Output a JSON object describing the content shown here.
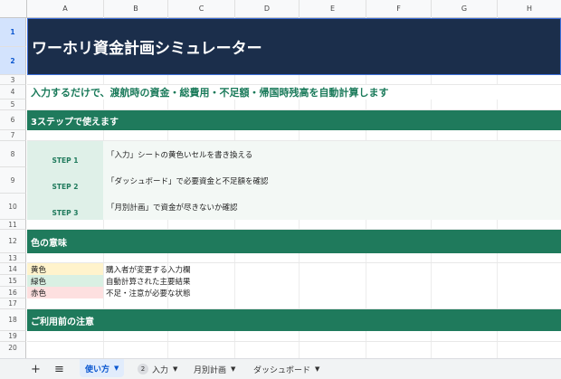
{
  "columns": [
    "A",
    "B",
    "C",
    "D",
    "E",
    "F",
    "G",
    "H"
  ],
  "rows": [
    "1",
    "2",
    "3",
    "4",
    "5",
    "6",
    "7",
    "8",
    "9",
    "10",
    "11",
    "12",
    "13",
    "14",
    "15",
    "16",
    "17",
    "18",
    "19",
    "20"
  ],
  "title": "ワーホリ資金計画シミュレーター",
  "subtitle": "入力するだけで、渡航時の資金・総費用・不足額・帰国時残高を自動計算します",
  "steps_section": "3ステップで使えます",
  "steps": [
    {
      "label": "STEP 1",
      "text": "「入力」シートの黄色いセルを書き換える"
    },
    {
      "label": "STEP 2",
      "text": "「ダッシュボード」で必要資金と不足額を確認"
    },
    {
      "label": "STEP 3",
      "text": "「月別計画」で資金が尽きないか確認"
    }
  ],
  "colors_section": "色の意味",
  "color_legend": [
    {
      "name": "黄色",
      "desc": "購入者が変更する入力欄",
      "color": "#fff3cc"
    },
    {
      "name": "緑色",
      "desc": "自動計算された主要結果",
      "color": "#d9f0e3"
    },
    {
      "name": "赤色",
      "desc": "不足・注意が必要な状態",
      "color": "#fde0e0"
    }
  ],
  "notes_section": "ご利用前の注意",
  "colors": {
    "title_bg": "#1b2e4b",
    "section_bg": "#1f7a5c",
    "accent": "#0b57d0"
  },
  "tabs": {
    "add_icon": "+",
    "list_icon": "≡",
    "items": [
      {
        "label": "使い方",
        "active": true
      },
      {
        "label": "入力",
        "badge": "2"
      },
      {
        "label": "月別計画"
      },
      {
        "label": "ダッシュボード"
      }
    ]
  }
}
